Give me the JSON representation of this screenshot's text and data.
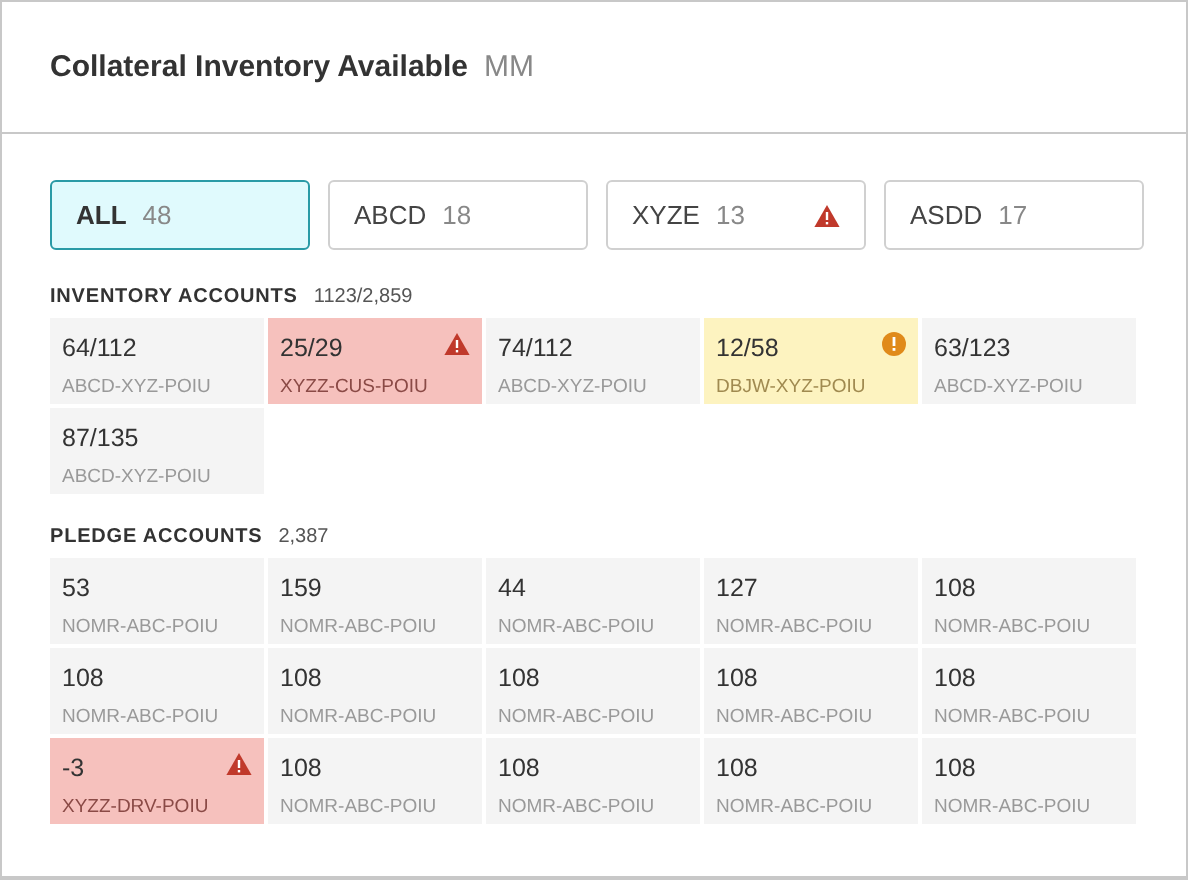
{
  "header": {
    "title": "Collateral Inventory Available",
    "unit": "MM"
  },
  "tabs": [
    {
      "label": "ALL",
      "count": "48",
      "selected": true,
      "alert": false
    },
    {
      "label": "ABCD",
      "count": "18",
      "selected": false,
      "alert": false
    },
    {
      "label": "XYZE",
      "count": "13",
      "selected": false,
      "alert": true
    },
    {
      "label": "ASDD",
      "count": "17",
      "selected": false,
      "alert": false
    }
  ],
  "sections": [
    {
      "title": "INVENTORY ACCOUNTS",
      "count": "1123/2,859",
      "tiles": [
        {
          "value": "64/112",
          "account": "ABCD-XYZ-POIU",
          "kind": "normal"
        },
        {
          "value": "25/29",
          "account": "XYZZ-CUS-POIU",
          "kind": "error"
        },
        {
          "value": "74/112",
          "account": "ABCD-XYZ-POIU",
          "kind": "normal"
        },
        {
          "value": "12/58",
          "account": "DBJW-XYZ-POIU",
          "kind": "warning"
        },
        {
          "value": "63/123",
          "account": "ABCD-XYZ-POIU",
          "kind": "normal"
        },
        {
          "value": "87/135",
          "account": "ABCD-XYZ-POIU",
          "kind": "normal"
        }
      ]
    },
    {
      "title": "PLEDGE ACCOUNTS",
      "count": "2,387",
      "tiles": [
        {
          "value": "53",
          "account": "NOMR-ABC-POIU",
          "kind": "normal"
        },
        {
          "value": "159",
          "account": "NOMR-ABC-POIU",
          "kind": "normal"
        },
        {
          "value": "44",
          "account": "NOMR-ABC-POIU",
          "kind": "normal"
        },
        {
          "value": "127",
          "account": "NOMR-ABC-POIU",
          "kind": "normal"
        },
        {
          "value": "108",
          "account": "NOMR-ABC-POIU",
          "kind": "normal"
        },
        {
          "value": "108",
          "account": "NOMR-ABC-POIU",
          "kind": "normal"
        },
        {
          "value": "108",
          "account": "NOMR-ABC-POIU",
          "kind": "normal"
        },
        {
          "value": "108",
          "account": "NOMR-ABC-POIU",
          "kind": "normal"
        },
        {
          "value": "108",
          "account": "NOMR-ABC-POIU",
          "kind": "normal"
        },
        {
          "value": "108",
          "account": "NOMR-ABC-POIU",
          "kind": "normal"
        },
        {
          "value": "-3",
          "account": "XYZZ-DRV-POIU",
          "kind": "error"
        },
        {
          "value": "108",
          "account": "NOMR-ABC-POIU",
          "kind": "normal"
        },
        {
          "value": "108",
          "account": "NOMR-ABC-POIU",
          "kind": "normal"
        },
        {
          "value": "108",
          "account": "NOMR-ABC-POIU",
          "kind": "normal"
        },
        {
          "value": "108",
          "account": "NOMR-ABC-POIU",
          "kind": "normal"
        }
      ]
    }
  ]
}
